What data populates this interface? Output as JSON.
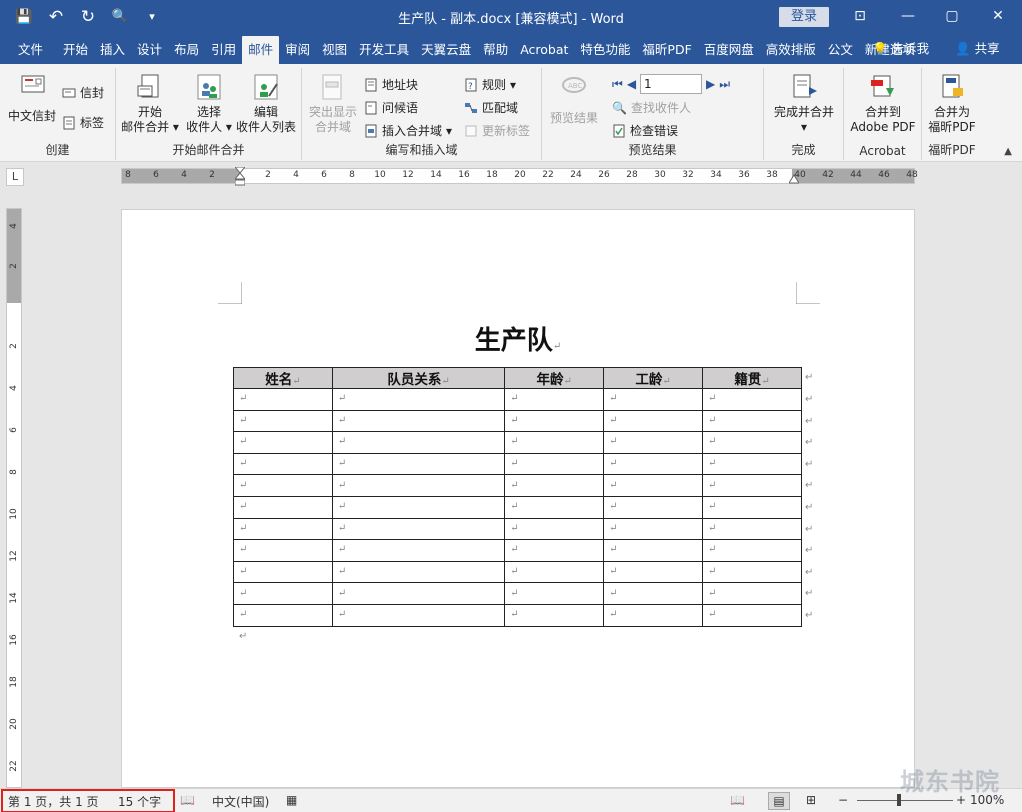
{
  "window": {
    "title": "生产队 - 副本.docx [兼容模式] - Word",
    "login": "登录",
    "minimize": "—",
    "restore": "▢",
    "close": "✕",
    "ribbon_display": "⊡"
  },
  "qat": {
    "save": "💾",
    "undo": "↶",
    "redo": "↻",
    "preview": "🔍",
    "customize": "▾"
  },
  "tabs": [
    "文件",
    "开始",
    "插入",
    "设计",
    "布局",
    "引用",
    "邮件",
    "审阅",
    "视图",
    "开发工具",
    "天翼云盘",
    "帮助",
    "Acrobat",
    "特色功能",
    "福昕PDF",
    "百度网盘",
    "高效排版",
    "公文",
    "新建选项"
  ],
  "active_tab": "邮件",
  "tell_me": "告诉我",
  "share": "共享",
  "ribbon": {
    "create": {
      "label": "创建",
      "envelope": "中文信封",
      "letter": "信封",
      "tag": "标签"
    },
    "start_merge": {
      "label": "开始邮件合并",
      "start_l1": "开始",
      "start_l2": "邮件合并",
      "select_l1": "选择",
      "select_l2": "收件人",
      "edit_l1": "编辑",
      "edit_l2": "收件人列表"
    },
    "write_insert": {
      "label": "编写和插入域",
      "highlight_l1": "突出显示",
      "highlight_l2": "合并域",
      "address": "地址块",
      "greeting": "问候语",
      "insert_field": "插入合并域",
      "rules": "规则",
      "match": "匹配域",
      "update": "更新标签"
    },
    "preview": {
      "label": "预览结果",
      "preview_btn": "预览结果",
      "record": "1",
      "find": "查找收件人",
      "check": "检查错误"
    },
    "finish": {
      "label": "完成",
      "btn": "完成并合并"
    },
    "acrobat": {
      "label": "Acrobat",
      "l1": "合并到",
      "l2": "Adobe PDF"
    },
    "foxit": {
      "label": "福昕PDF",
      "l1": "合并为",
      "l2": "福昕PDF"
    }
  },
  "ruler": {
    "corner": "L",
    "h_numbers": [
      "8",
      "6",
      "4",
      "2",
      "2",
      "4",
      "6",
      "8",
      "10",
      "12",
      "14",
      "16",
      "18",
      "20",
      "22",
      "24",
      "26",
      "28",
      "30",
      "32",
      "34",
      "36",
      "38",
      "40",
      "42",
      "44",
      "46",
      "48"
    ],
    "v_numbers": [
      "4",
      "2",
      "2",
      "4",
      "6",
      "8",
      "10",
      "12",
      "14",
      "16",
      "18",
      "20",
      "22"
    ]
  },
  "document": {
    "title": "生产队",
    "para_mark": "↵",
    "table": {
      "headers": [
        "姓名",
        "队员关系",
        "年龄",
        "工龄",
        "籍贯"
      ],
      "rows": 11
    }
  },
  "status": {
    "page": "第 1 页，共 1 页",
    "words": "15 个字",
    "language": "中文(中国)",
    "zoom": "100%",
    "minus": "−",
    "plus": "+"
  },
  "watermark": "城东书院"
}
